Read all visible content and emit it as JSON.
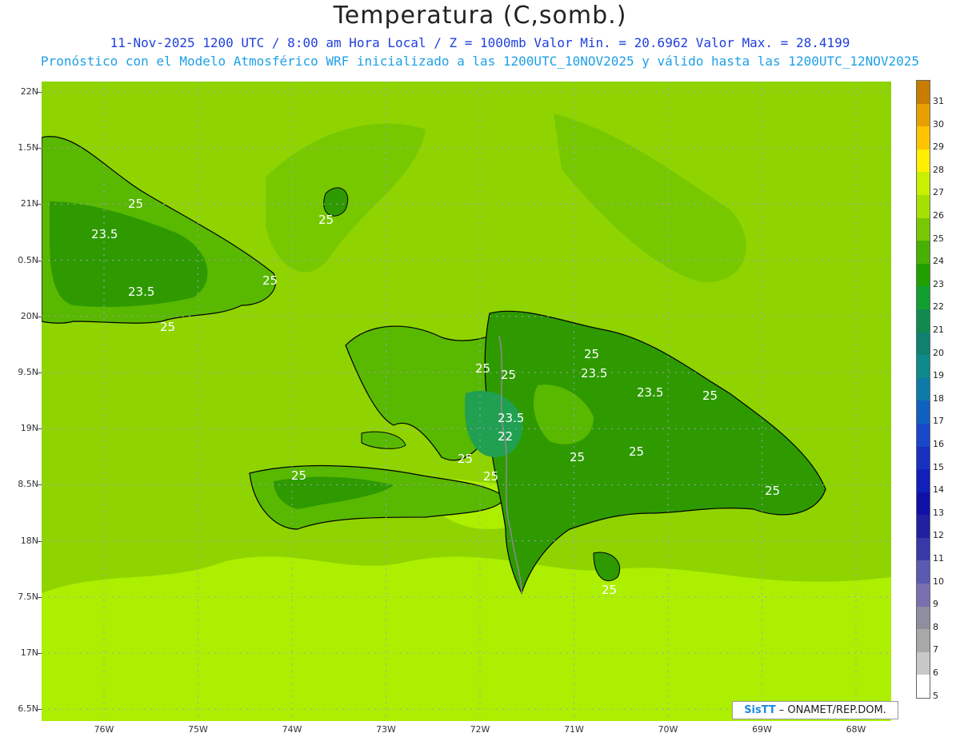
{
  "header": {
    "title": "Temperatura (C,somb.)",
    "subtitle_line1": "11-Nov-2025  1200 UTC / 8:00 am Hora Local / Z = 1000mb   Valor Min. = 20.6962  Valor Max. = 28.4199",
    "subtitle_line2": "Pronóstico con el Modelo Atmosférico WRF inicializado a las 1200UTC_10NOV2025 y válido hasta las  1200UTC_12NOV2025"
  },
  "map": {
    "lat_labels": [
      "22N",
      "1.5N",
      "21N",
      "0.5N",
      "20N",
      "9.5N",
      "19N",
      "8.5N",
      "18N",
      "7.5N",
      "17N",
      "6.5N"
    ],
    "lon_labels": [
      "76W",
      "75W",
      "74W",
      "73W",
      "72W",
      "71W",
      "70W",
      "69W",
      "68W"
    ],
    "contour_labels": [
      "25",
      "23.5",
      "25",
      "23.5",
      "25",
      "25",
      "25",
      "25",
      "25",
      "23.5",
      "23.5",
      "25",
      "23.5",
      "22",
      "25",
      "25",
      "25",
      "25",
      "25",
      "25",
      "25"
    ],
    "colors": {
      "ocean_base": "#8fd400",
      "warm_band": "#acef00",
      "land_mid": "#59b800",
      "land_cool": "#2e9a00",
      "land_coolest": "#20a050",
      "coastline": "#000000",
      "border": "#8a8a8a"
    }
  },
  "credit": {
    "brand": "SisTT",
    "text": "– ONAMET/REP.DOM."
  },
  "colorbar": {
    "labels": [
      "31",
      "30",
      "29",
      "28",
      "27",
      "26",
      "25",
      "24",
      "23",
      "22",
      "21",
      "20",
      "19",
      "18",
      "17",
      "16",
      "15",
      "14",
      "13",
      "12",
      "11",
      "10",
      "9",
      "8",
      "7",
      "6",
      "5"
    ],
    "colors": [
      "#c87d00",
      "#e8a000",
      "#ffc400",
      "#ffee00",
      "#c8f000",
      "#a6e000",
      "#78c800",
      "#48b000",
      "#20a000",
      "#10a030",
      "#108a50",
      "#108070",
      "#0f8a8a",
      "#0f7aa8",
      "#1060c0",
      "#1848c8",
      "#1830c0",
      "#1020b8",
      "#1010a8",
      "#2020a0",
      "#3838a8",
      "#5a5ab0",
      "#7a70b0",
      "#8e8e9e",
      "#a8a8a8",
      "#c8c8c8",
      "#ffffff"
    ]
  }
}
